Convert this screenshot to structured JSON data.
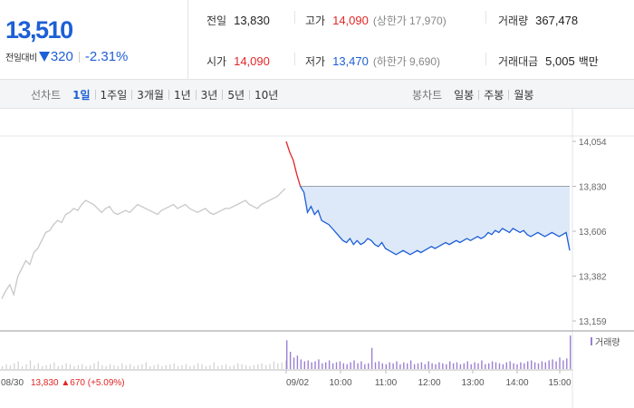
{
  "quote": {
    "price": "13,510",
    "change_label": "전일대비",
    "change_amount": "320",
    "change_percent": "-2.31%"
  },
  "stats": {
    "prev_close": {
      "label": "전일",
      "value": "13,830"
    },
    "high": {
      "label": "고가",
      "value": "14,090",
      "sub_label": "(상한가",
      "sub_value": "17,970)"
    },
    "volume": {
      "label": "거래량",
      "value": "367,478"
    },
    "open": {
      "label": "시가",
      "value": "14,090"
    },
    "low": {
      "label": "저가",
      "value": "13,470",
      "sub_label": "(하한가",
      "sub_value": "9,690)"
    },
    "turnover": {
      "label": "거래대금",
      "value": "5,005",
      "unit": "백만"
    }
  },
  "toolbar": {
    "line_title": "선차트",
    "line_periods": [
      "1일",
      "1주일",
      "3개월",
      "1년",
      "3년",
      "5년",
      "10년"
    ],
    "line_active": 0,
    "candle_title": "봉차트",
    "candle_periods": [
      "일봉",
      "주봉",
      "월봉"
    ]
  },
  "colors": {
    "down": "#1d5fd6",
    "up": "#e22626",
    "prev_day_line": "#c8c8c8",
    "fill": "#dde9f8",
    "volume_today": "#9c7fd1",
    "volume_prev": "#d0d0d0"
  },
  "chart_data": {
    "type": "line",
    "y_ticks": [
      "14,054",
      "13,830",
      "13,606",
      "13,382",
      "13,159"
    ],
    "x_ticks": [
      "08/30",
      "09/02",
      "10:00",
      "11:00",
      "12:00",
      "13:00",
      "14:00",
      "15:00"
    ],
    "ylim": [
      13159,
      14054
    ],
    "prev_close": 13830,
    "prev_day_label": {
      "date": "08/30",
      "close": "13,830",
      "change": "▲670",
      "pct": "(+5.09%)"
    },
    "volume_legend": "거래량",
    "prev_day_series": [
      13270,
      13310,
      13340,
      13290,
      13380,
      13420,
      13460,
      13440,
      13500,
      13520,
      13560,
      13600,
      13610,
      13640,
      13660,
      13650,
      13690,
      13700,
      13720,
      13710,
      13740,
      13760,
      13750,
      13740,
      13720,
      13700,
      13720,
      13730,
      13700,
      13690,
      13700,
      13710,
      13700,
      13720,
      13740,
      13730,
      13720,
      13710,
      13700,
      13690,
      13710,
      13720,
      13730,
      13740,
      13720,
      13730,
      13740,
      13720,
      13710,
      13700,
      13710,
      13720,
      13700,
      13690,
      13700,
      13710,
      13720,
      13720,
      13730,
      13740,
      13750,
      13760,
      13740,
      13730,
      13720,
      13740,
      13750,
      13760,
      13770,
      13780,
      13800,
      13820
    ],
    "today_series": [
      14054,
      14000,
      13960,
      13890,
      13830,
      13800,
      13700,
      13730,
      13690,
      13710,
      13660,
      13650,
      13640,
      13620,
      13600,
      13580,
      13560,
      13550,
      13570,
      13540,
      13560,
      13540,
      13550,
      13570,
      13560,
      13540,
      13530,
      13550,
      13520,
      13510,
      13500,
      13490,
      13500,
      13510,
      13500,
      13490,
      13500,
      13510,
      13500,
      13510,
      13520,
      13530,
      13520,
      13530,
      13540,
      13550,
      13540,
      13550,
      13560,
      13550,
      13560,
      13570,
      13560,
      13570,
      13580,
      13570,
      13580,
      13600,
      13590,
      13610,
      13600,
      13620,
      13610,
      13600,
      13620,
      13610,
      13600,
      13610,
      13590,
      13580,
      13590,
      13600,
      13590,
      13580,
      13590,
      13600,
      13590,
      13580,
      13590,
      13600,
      13510
    ],
    "prev_volumes": [
      3,
      5,
      4,
      6,
      8,
      3,
      5,
      9,
      4,
      6,
      3,
      4,
      5,
      7,
      3,
      4,
      6,
      5,
      3,
      4,
      5,
      3,
      4,
      6,
      8,
      4,
      3,
      5,
      4,
      3,
      6,
      4,
      5,
      3,
      4,
      5,
      7,
      3,
      4,
      5,
      3,
      4,
      5,
      6,
      3,
      4,
      5,
      3,
      4,
      6,
      5,
      3,
      4,
      7,
      3,
      4,
      5,
      3,
      4,
      6,
      5,
      4,
      3,
      4,
      5,
      6,
      4,
      5,
      8,
      6,
      7,
      9
    ],
    "today_volumes": [
      30,
      18,
      12,
      14,
      10,
      8,
      9,
      7,
      8,
      10,
      6,
      7,
      9,
      6,
      7,
      8,
      6,
      5,
      7,
      9,
      6,
      8,
      5,
      6,
      22,
      7,
      8,
      6,
      5,
      7,
      6,
      8,
      5,
      7,
      6,
      9,
      5,
      6,
      7,
      5,
      8,
      6,
      5,
      7,
      6,
      5,
      8,
      6,
      7,
      5,
      6,
      8,
      5,
      7,
      6,
      9,
      5,
      6,
      8,
      7,
      6,
      5,
      7,
      8,
      6,
      5,
      7,
      6,
      8,
      9,
      7,
      6,
      8,
      7,
      9,
      10,
      8,
      12,
      9,
      11,
      35
    ]
  }
}
